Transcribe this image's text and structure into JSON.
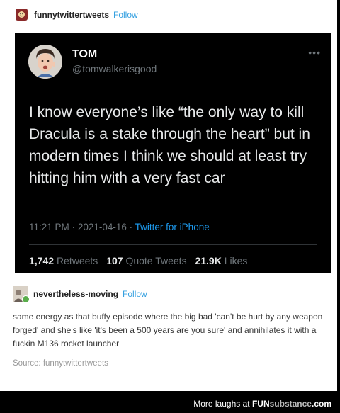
{
  "post": {
    "username": "funnytwittertweets",
    "follow_label": "Follow"
  },
  "tweet": {
    "display_name": "TOM",
    "handle": "@tomwalkerisgood",
    "more_icon": "ellipsis-icon",
    "text": "I know everyone’s like “the only way to kill Dracula is a stake through the heart” but in modern times I think we should at least try hitting him with a very fast car",
    "time": "11:21 PM",
    "date": "2021-04-16",
    "separator": "·",
    "source": "Twitter for iPhone",
    "stats": [
      {
        "count": "1,742",
        "label": "Retweets"
      },
      {
        "count": "107",
        "label": "Quote Tweets"
      },
      {
        "count": "21.9K",
        "label": "Likes"
      }
    ]
  },
  "reblog": {
    "username": "nevertheless-moving",
    "follow_label": "Follow",
    "text": "same energy as that buffy episode where the big bad 'can't be hurt by any weapon forged' and she's like 'it's been a 500 years are you sure' and annihilates it with a fuckin M136 rocket launcher"
  },
  "source": {
    "label": "Source:",
    "name": "funnytwittertweets"
  },
  "watermark": {
    "text": "More laughs at",
    "brand": "FUN",
    "brand_sub": "substance",
    "brand_tld": ".com"
  },
  "colors": {
    "follow": "#35a0e0",
    "twitter_link": "#1d9bf0",
    "tweet_bg": "#000000",
    "page_bg": "#ffffff"
  }
}
